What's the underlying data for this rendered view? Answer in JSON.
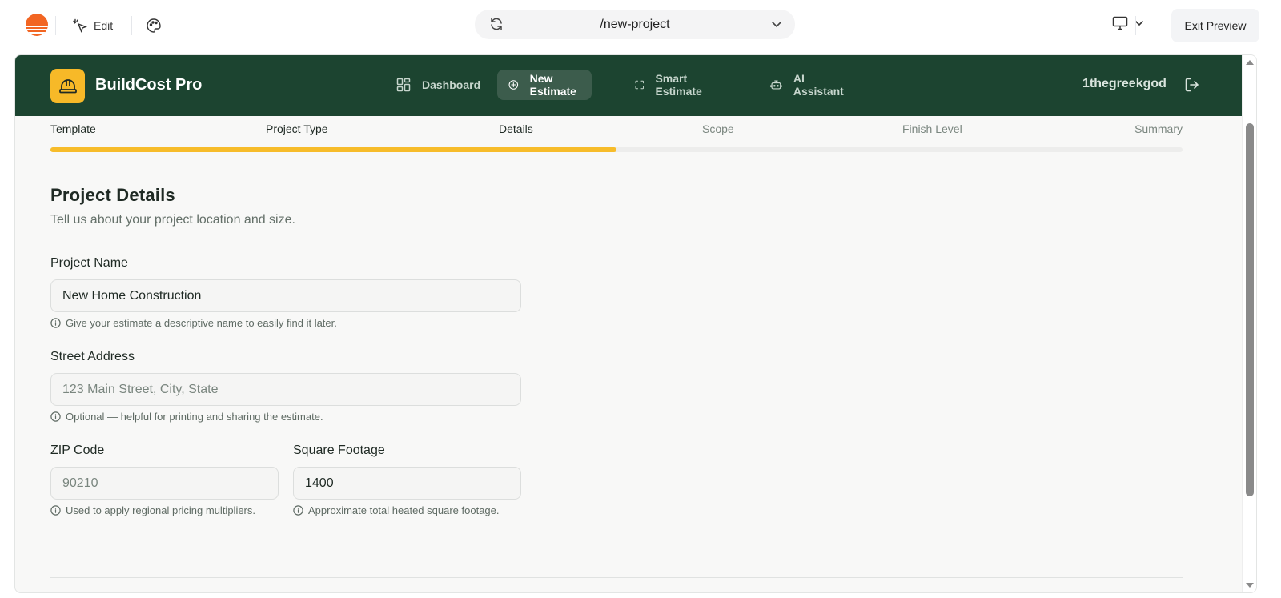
{
  "toolbar": {
    "edit_label": "Edit",
    "url": "/new-project",
    "exit_label": "Exit Preview"
  },
  "app": {
    "name": "BuildCost Pro",
    "nav": [
      {
        "label": "Dashboard",
        "icon": "grid-icon",
        "active": false
      },
      {
        "label": "New Estimate",
        "icon": "plus-circle-icon",
        "active": true
      },
      {
        "label": "Smart Estimate",
        "icon": "scan-icon",
        "active": false
      },
      {
        "label": "AI Assistant",
        "icon": "robot-icon",
        "active": false
      }
    ],
    "username": "1thegreekgod"
  },
  "stepper": {
    "steps": [
      "Template",
      "Project Type",
      "Details",
      "Scope",
      "Finish Level",
      "Summary"
    ],
    "current_step": 3,
    "progress_fraction": 0.5
  },
  "form": {
    "title": "Project Details",
    "subtitle": "Tell us about your project location and size.",
    "project_name": {
      "label": "Project Name",
      "value": "New Home Construction",
      "hint": "Give your estimate a descriptive name to easily find it later."
    },
    "street_address": {
      "label": "Street Address",
      "placeholder": "123 Main Street, City, State",
      "hint": "Optional — helpful for printing and sharing the estimate."
    },
    "zip_code": {
      "label": "ZIP Code",
      "placeholder": "90210",
      "hint": "Used to apply regional pricing multipliers."
    },
    "square_footage": {
      "label": "Square Footage",
      "value": "1400",
      "hint": "Approximate total heated square footage."
    }
  },
  "colors": {
    "header_bg": "#1c4430",
    "accent": "#f7bc2a",
    "nav_active_bg": "#3c5c4c"
  }
}
